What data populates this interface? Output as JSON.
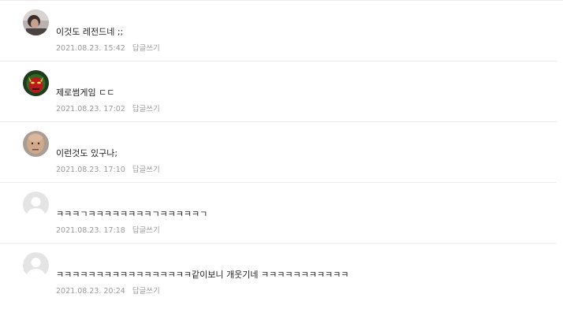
{
  "comments": [
    {
      "avatar_icon": "user-photo-icon",
      "text": "이것도 레전드네 ;;",
      "date": "2021.08.23. 15:42",
      "reply_label": "답글쓰기"
    },
    {
      "avatar_icon": "red-demon-avatar-icon",
      "text": "제로썸게임 ㄷㄷ",
      "date": "2021.08.23. 17:02",
      "reply_label": "답글쓰기"
    },
    {
      "avatar_icon": "bald-man-avatar-icon",
      "text": "이런것도 있구나;",
      "date": "2021.08.23. 17:10",
      "reply_label": "답글쓰기"
    },
    {
      "avatar_icon": "default-user-icon",
      "text": "ㅋㅋㅋㄱㅋㅋㅋㅋㅋㅋㅋㅋㄱㅋㅋㅋㅋㅋㄱ",
      "date": "2021.08.23. 17:18",
      "reply_label": "답글쓰기"
    },
    {
      "avatar_icon": "default-user-icon",
      "text": "ㅋㅋㅋㅋㅋㅋㅋㅋㅋㅋㅋㅋㅋㅋㅋㅋㅋ같이보니 개웃기네 ㅋㅋㅋㅋㅋㅋㅋㅋㅋㅋㅋ",
      "date": "2021.08.23. 20:24",
      "reply_label": "답글쓰기"
    }
  ]
}
